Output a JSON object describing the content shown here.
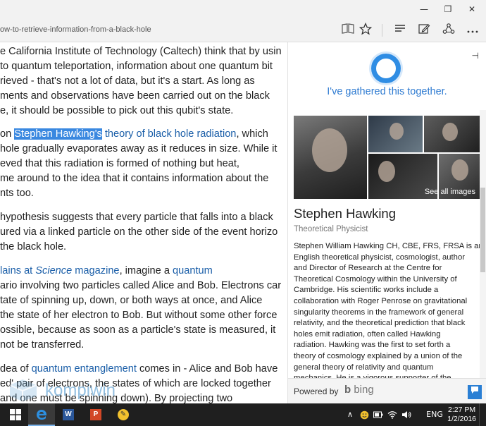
{
  "window": {
    "minimize_glyph": "—",
    "maximize_glyph": "❐",
    "close_glyph": "✕"
  },
  "addressbar": {
    "url": "ow-to-retrieve-information-from-a-black-hole",
    "reading_view_icon": "book-icon",
    "favorite_icon": "star-icon",
    "hub_icon": "hub-icon",
    "note_icon": "web-note-icon",
    "share_icon": "share-icon",
    "more_icon": "more-icon"
  },
  "article": {
    "p1": [
      "e California Institute of Technology (Caltech) think that by usin",
      "to quantum teleportation, information about one quantum bit",
      "rieved - that's not a lot of data, but it's a start. As long as",
      "ments and observations have been carried out on the black",
      "e, it should be possible to pick out this qubit's state."
    ],
    "p2_line1_pre": "on ",
    "p2_highlight": "Stephen Hawking's",
    "p2_link": " theory of black hole radiation",
    "p2_line1_post": ", which",
    "p2": [
      "hole gradually evaporates away as it reduces in size. While it",
      "eved that this radiation is formed of nothing but heat,",
      "me around to the idea that it contains information about the",
      "nts too."
    ],
    "p3": [
      "hypothesis suggests that every particle that falls into a black",
      "ured via a linked particle on the other side of the event horizo",
      "the black hole."
    ],
    "p4_link_pre": "lains at ",
    "p4_link_italic": "Science",
    "p4_link_post": " magazine",
    "p4_mid": ", imagine a ",
    "p4_link2": "quantum",
    "p4": [
      "ario involving two particles called Alice and Bob. Electrons car",
      "tate of spinning up, down, or both ways at once, and Alice",
      "the state of her electron to Bob. But without some other force",
      "ossible, because as soon as a particle's state is measured, it",
      "not be transferred."
    ],
    "p5_pre": "dea of ",
    "p5_link": "quantum entanglement",
    "p5_post": " comes in - Alice and Bob have",
    "p5": [
      "ed' pair of electrons, the states of which are locked together",
      "and one must be spinning down). By projecting two"
    ]
  },
  "cortana": {
    "pin_glyph": "⊣",
    "message": "I've gathered this together.",
    "see_all_images": "See all images",
    "entity_name": "Stephen Hawking",
    "entity_subtitle": "Theoretical Physicist",
    "description": [
      "Stephen William Hawking CH, CBE, FRS, FRSA is an",
      "English theoretical physicist, cosmologist, author",
      "and Director of Research at the Centre for",
      "Theoretical Cosmology within the University of",
      "Cambridge. His scientific works include a",
      "collaboration with Roger Penrose on gravitational",
      "singularity theorems in the framework of general",
      "relativity, and the theoretical prediction that black",
      "holes emit radiation, often called Hawking",
      "radiation. Hawking was the first to set forth a",
      "theory of cosmology explained by a union of the",
      "general theory of relativity and quantum",
      "mechanics. He is a vigorous supporter of the"
    ],
    "powered_by": "Powered by",
    "bing_glyph": "b",
    "bing": "bing",
    "feedback_icon": "feedback-icon"
  },
  "watermark": {
    "text": "kompiwin"
  },
  "taskbar": {
    "word_label": "W",
    "ppt_label": "P",
    "paint_label": "✎",
    "tray_chevron": "∧",
    "lang": "ENG",
    "time": "2:27 PM",
    "date": "1/2/2016",
    "colors": {
      "edge": "#2d8fe0",
      "word": "#2b579a",
      "powerpoint": "#d24726",
      "paint": "#f2c12e"
    }
  }
}
